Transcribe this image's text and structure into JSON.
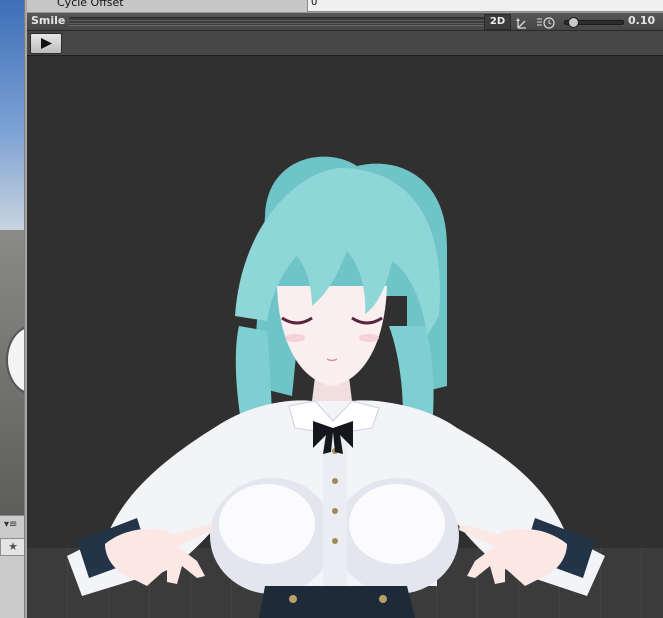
{
  "inspector": {
    "cycle_offset_label": "Cycle Offset",
    "cycle_offset_value": "0"
  },
  "preview": {
    "title": "Smile",
    "mode_2d_label": "2D",
    "speed_value": "0.10",
    "speed_fraction": 0.1,
    "play_icon": "play-icon",
    "pivot_icon": "pivot-icon",
    "light_icon": "light-icon"
  },
  "left_panel": {
    "menu_icon": "panel-menu-icon",
    "favorite_icon": "star-icon"
  },
  "colors": {
    "viewport_bg": "#303030",
    "header_bg": "#4e4e4e",
    "hair": "#8fd3d6",
    "shirt": "#f4f5f8",
    "ribbon": "#15171c"
  }
}
